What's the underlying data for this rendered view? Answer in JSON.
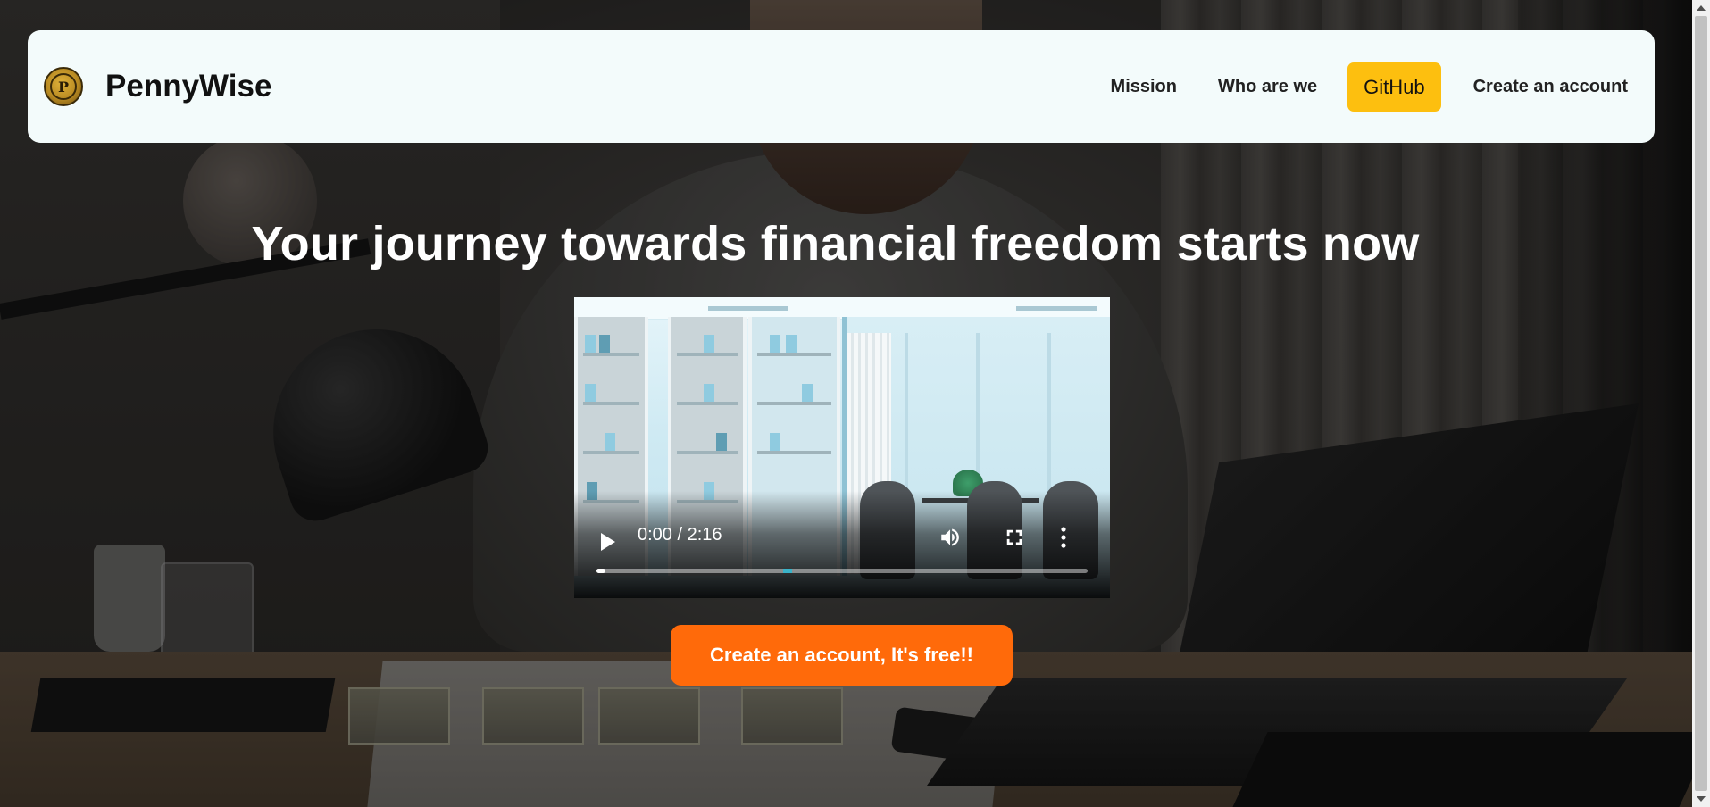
{
  "brand": {
    "name": "PennyWise",
    "logo_icon": "coin-p-icon",
    "logo_letter": "P"
  },
  "nav": {
    "items": [
      {
        "label": "Mission"
      },
      {
        "label": "Who are we"
      },
      {
        "label": "GitHub"
      },
      {
        "label": "Create an account"
      }
    ]
  },
  "hero": {
    "title": "Your journey towards financial freedom starts now"
  },
  "video": {
    "time_display": "0:00 / 2:16",
    "current_time": "0:00",
    "duration": "2:16",
    "played_fraction": 0.0,
    "buffered_marker_fraction": 0.38,
    "controls": {
      "play": "play-icon",
      "volume": "volume-icon",
      "fullscreen": "fullscreen-icon",
      "more": "more-options-icon"
    }
  },
  "cta": {
    "label": "Create an account, It's free!!"
  },
  "colors": {
    "navbar_bg": "#f3fbfb",
    "github_button": "#fdbf0f",
    "cta_button": "#ff6a0a",
    "progress_buffer": "#3ab3c9"
  }
}
